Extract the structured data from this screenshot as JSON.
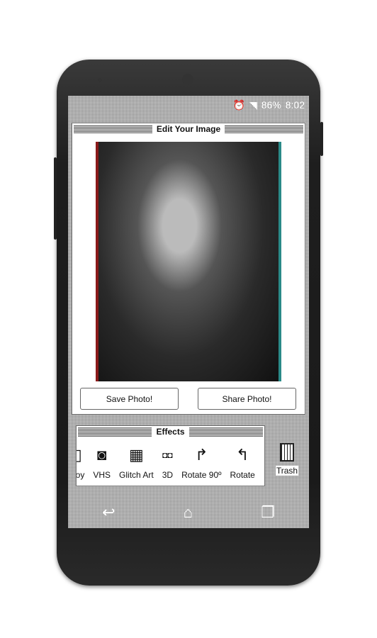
{
  "status": {
    "battery": "86%",
    "time": "8:02",
    "icons": [
      "alarm-icon",
      "wifi-icon",
      "signal-icon"
    ]
  },
  "editor": {
    "title": "Edit Your Image",
    "save_label": "Save Photo!",
    "share_label": "Share Photo!"
  },
  "effects": {
    "title": "Effects",
    "items": [
      {
        "label": "boy",
        "icon": "gameboy-icon"
      },
      {
        "label": "VHS",
        "icon": "vhs-icon"
      },
      {
        "label": "Glitch Art",
        "icon": "glitch-icon"
      },
      {
        "label": "3D",
        "icon": "3d-glasses-icon"
      },
      {
        "label": "Rotate 90º",
        "icon": "rotate-right-icon"
      },
      {
        "label": "Rotate",
        "icon": "rotate-left-icon"
      }
    ]
  },
  "trash": {
    "label": "Trash"
  }
}
